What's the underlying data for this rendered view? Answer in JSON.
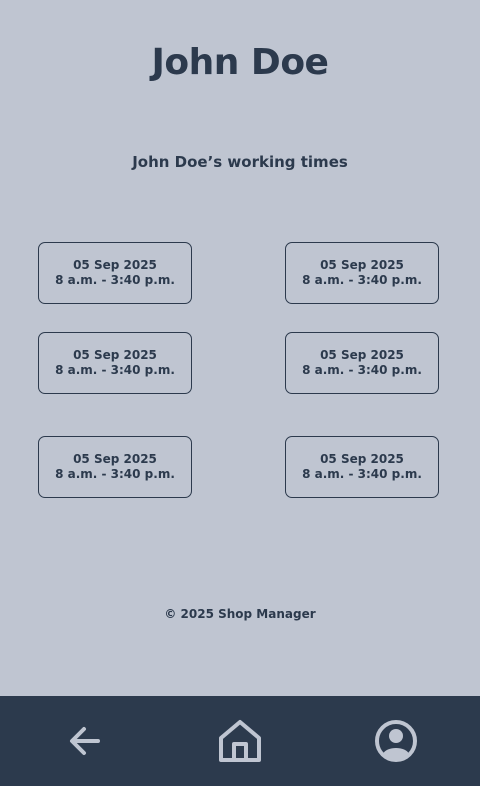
{
  "header": {
    "title": "John Doe",
    "subtitle": "John Doe’s working times"
  },
  "schedule": [
    {
      "date": "05 Sep 2025",
      "time": "8 a.m. - 3:40 p.m."
    },
    {
      "date": "05 Sep 2025",
      "time": "8 a.m. - 3:40 p.m."
    },
    {
      "date": "05 Sep 2025",
      "time": "8 a.m. - 3:40 p.m."
    },
    {
      "date": "05 Sep 2025",
      "time": "8 a.m. - 3:40 p.m."
    },
    {
      "date": "05 Sep 2025",
      "time": "8 a.m. - 3:40 p.m."
    },
    {
      "date": "05 Sep 2025",
      "time": "8 a.m. - 3:40 p.m."
    }
  ],
  "footer": {
    "copyright": "© 2025 Shop Manager"
  },
  "bottom_nav": {
    "items": [
      {
        "icon": "arrow-left-icon"
      },
      {
        "icon": "home-icon"
      },
      {
        "icon": "user-circle-icon"
      }
    ]
  },
  "colors": {
    "background": "#bfc5d1",
    "text": "#2c3a4d",
    "nav_background": "#2c3a4d",
    "nav_icon": "#bfc5d1"
  }
}
